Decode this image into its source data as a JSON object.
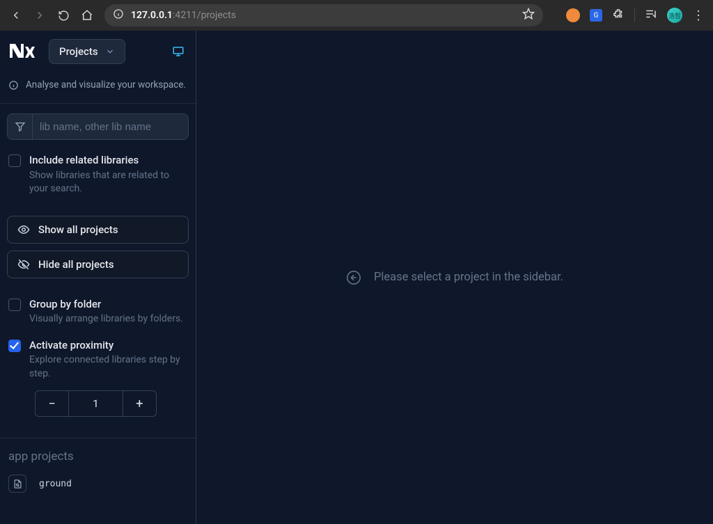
{
  "browser": {
    "url_host": "127.0.0.1",
    "url_rest": ":4211/projects",
    "avatar_text": "浩哲"
  },
  "header": {
    "selector_label": "Projects",
    "headline": "Analyse and visualize your workspace."
  },
  "filter": {
    "placeholder": "lib name, other lib name"
  },
  "options": {
    "include_related": {
      "title": "Include related libraries",
      "desc": "Show libraries that are related to your search."
    },
    "group_by_folder": {
      "title": "Group by folder",
      "desc": "Visually arrange libraries by folders."
    },
    "activate_proximity": {
      "title": "Activate proximity",
      "desc": "Explore connected libraries step by step.",
      "value": "1"
    }
  },
  "actions": {
    "show_all": "Show all projects",
    "hide_all": "Hide all projects"
  },
  "projects": {
    "section_title": "app projects",
    "items": [
      {
        "name": "ground"
      }
    ]
  },
  "main": {
    "placeholder": "Please select a project in the sidebar."
  }
}
